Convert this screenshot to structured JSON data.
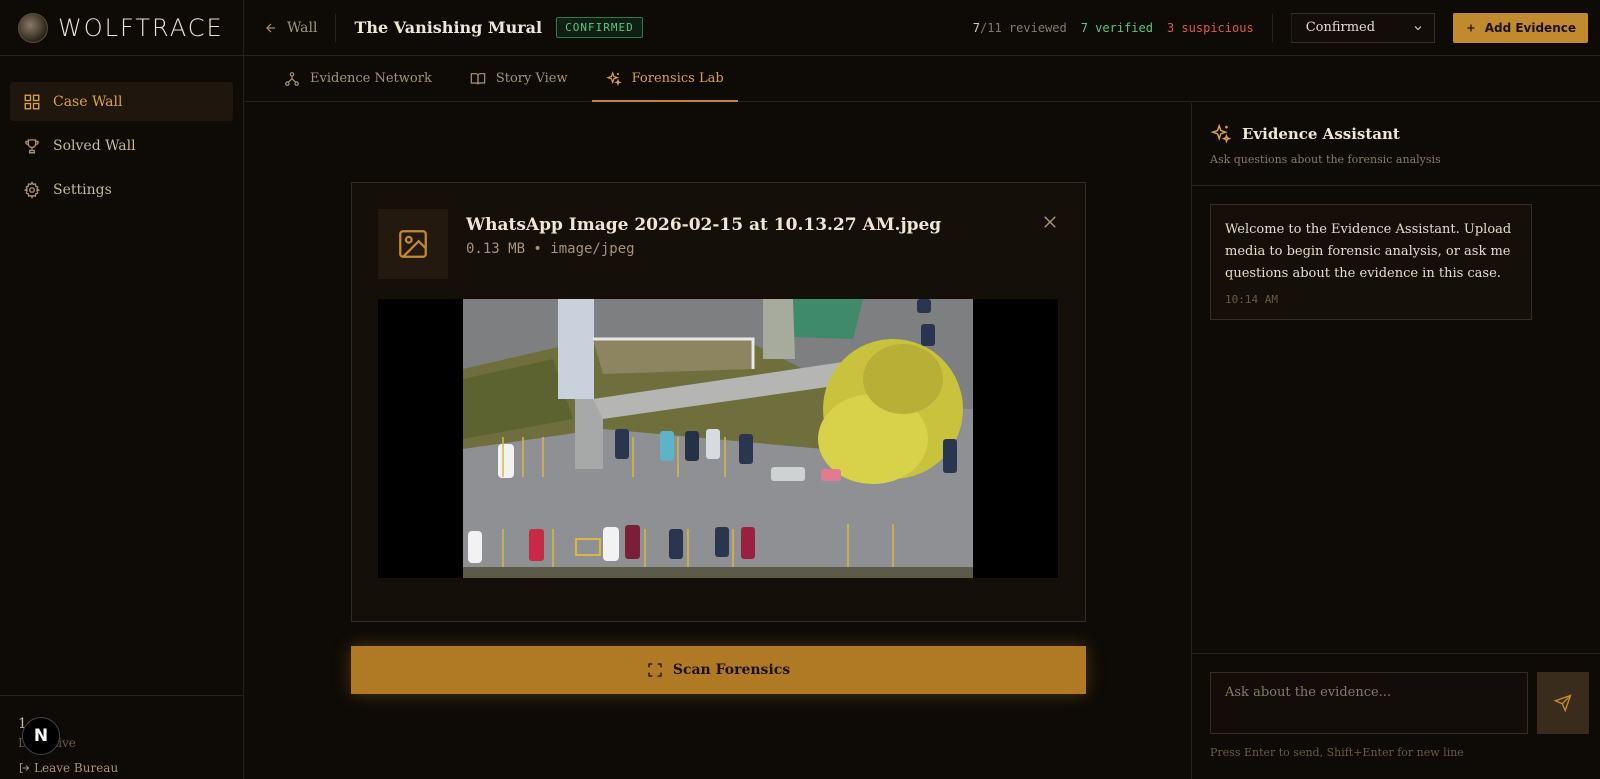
{
  "brand": {
    "name": "WOLFTRACE"
  },
  "sidebar": {
    "items": [
      {
        "label": "Case Wall",
        "icon": "grid-icon",
        "active": true
      },
      {
        "label": "Solved Wall",
        "icon": "trophy-icon",
        "active": false
      },
      {
        "label": "Settings",
        "icon": "gear-icon",
        "active": false
      }
    ],
    "footer": {
      "count": "1",
      "role": "Detective",
      "leave_label": "Leave Bureau",
      "badge": "N"
    }
  },
  "header": {
    "back_label": "Wall",
    "case_title": "The Vanishing Mural",
    "status_badge": "CONFIRMED",
    "stats": {
      "reviewed_count": "7",
      "reviewed_total": "/11 reviewed",
      "verified": "7 verified",
      "suspicious": "3 suspicious"
    },
    "status_select": "Confirmed",
    "add_button": "Add Evidence"
  },
  "tabs": [
    {
      "label": "Evidence Network",
      "icon": "network-icon",
      "active": false
    },
    {
      "label": "Story View",
      "icon": "book-icon",
      "active": false
    },
    {
      "label": "Forensics Lab",
      "icon": "sparkles-icon",
      "active": true
    }
  ],
  "lab": {
    "file_name": "WhatsApp Image 2026-02-15 at 10.13.27 AM.jpeg",
    "file_meta": "0.13 MB • image/jpeg",
    "scan_button": "Scan Forensics"
  },
  "assistant": {
    "title": "Evidence Assistant",
    "subtitle": "Ask questions about the forensic analysis",
    "welcome_message": "Welcome to the Evidence Assistant. Upload media to begin forensic analysis, or ask me questions about the evidence in this case.",
    "welcome_time": "10:14 AM",
    "input_placeholder": "Ask about the evidence...",
    "hint": "Press Enter to send, Shift+Enter for new line"
  },
  "colors": {
    "accent": "#c28a2e",
    "background": "#0e0a06",
    "verified": "#5ec47e",
    "suspicious": "#e05a4a"
  }
}
